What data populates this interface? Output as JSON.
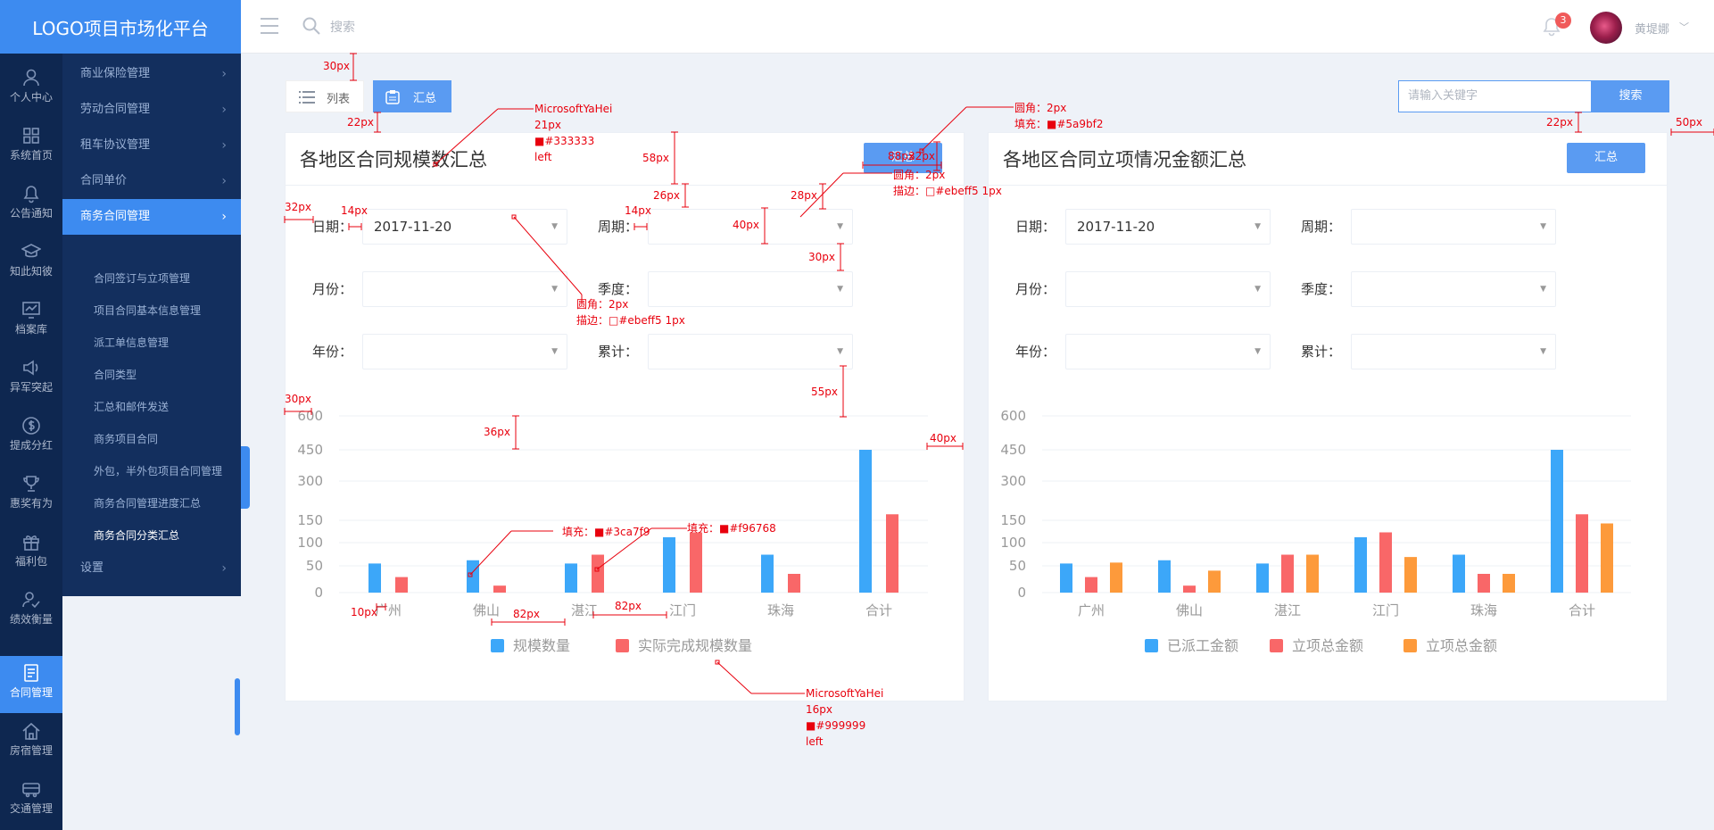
{
  "app": {
    "title": "LOGO项目市场化平台",
    "search_placeholder": "搜索",
    "notification_count": "3",
    "user_name": "黄堤娜"
  },
  "rail": [
    {
      "label": "个人中心",
      "icon": "user-icon"
    },
    {
      "label": "系统首页",
      "icon": "grid-icon"
    },
    {
      "label": "公告通知",
      "icon": "bell-icon"
    },
    {
      "label": "知此知彼",
      "icon": "cap-icon"
    },
    {
      "label": "档案库",
      "icon": "chart-icon"
    },
    {
      "label": "异军突起",
      "icon": "speaker-icon"
    },
    {
      "label": "提成分红",
      "icon": "dollar-icon"
    },
    {
      "label": "惠奖有为",
      "icon": "trophy-icon"
    },
    {
      "label": "福利包",
      "icon": "gift-icon"
    },
    {
      "label": "绩效衡量",
      "icon": "person-check-icon"
    },
    {
      "label": "合同管理",
      "icon": "contract-icon",
      "active": true
    },
    {
      "label": "房宿管理",
      "icon": "home-icon"
    },
    {
      "label": "交通管理",
      "icon": "bus-icon"
    }
  ],
  "subnav": {
    "groups": [
      "商业保险管理",
      "劳动合同管理",
      "租车协议管理",
      "合同单价",
      "商务合同管理"
    ],
    "active_group": "商务合同管理",
    "children": [
      "合同签订与立项管理",
      "项目合同基本信息管理",
      "派工单信息管理",
      "合同类型",
      "汇总和邮件发送",
      "商务项目合同",
      "外包，半外包项目合同管理",
      "商务合同管理进度汇总",
      "商务合同分类汇总"
    ],
    "current_child": "商务合同分类汇总",
    "settings": "设置"
  },
  "toolbar": {
    "list_label": "列表",
    "summary_label": "汇总",
    "keyword_placeholder": "请输入关键字",
    "search_button": "搜索"
  },
  "filters": {
    "date_label": "日期：",
    "date_value": "2017-11-20",
    "period_label": "周期：",
    "month_label": "月份：",
    "quarter_label": "季度：",
    "year_label": "年份：",
    "total_label": "累计："
  },
  "cards": [
    {
      "title": "各地区合同规模数汇总",
      "button": "汇总"
    },
    {
      "title": "各地区合同立项情况金额汇总",
      "button": "汇总"
    }
  ],
  "chart_data": [
    {
      "type": "bar",
      "categories": [
        "广州",
        "佛山",
        "湛江",
        "江门",
        "珠海",
        "合计"
      ],
      "ylim": [
        0,
        600
      ],
      "yticks": [
        0,
        50,
        100,
        150,
        300,
        450,
        600
      ],
      "series": [
        {
          "name": "规模数量",
          "values": [
            55,
            62,
            55,
            112,
            74,
            450
          ],
          "color": "#3ca7f9"
        },
        {
          "name": "实际完成规模数量",
          "values": [
            29,
            13,
            74,
            123,
            35,
            173
          ],
          "color": "#f96768"
        }
      ],
      "legend": "bottom-center"
    },
    {
      "type": "bar",
      "categories": [
        "广州",
        "佛山",
        "湛江",
        "江门",
        "珠海",
        "合计"
      ],
      "ylim": [
        0,
        600
      ],
      "yticks": [
        0,
        50,
        100,
        150,
        300,
        450,
        600
      ],
      "series": [
        {
          "name": "已派工金额",
          "values": [
            55,
            62,
            55,
            112,
            74,
            450
          ],
          "color": "#3ca7f9"
        },
        {
          "name": "立项总金额",
          "values": [
            29,
            13,
            74,
            123,
            35,
            173
          ],
          "color": "#f96768"
        },
        {
          "name": "立项总金额",
          "values": [
            57,
            41,
            74,
            69,
            35,
            143
          ],
          "color": "#fd9a3b"
        }
      ],
      "legend": "bottom-center"
    }
  ],
  "annotations": {
    "a30": "30px",
    "a22a": "22px",
    "font1_name": "MicrosoftYaHei",
    "font1_size": "21px",
    "font1_color": "■#333333",
    "font1_align": "left",
    "a58": "58px",
    "a26": "26px",
    "a28": "28px",
    "a88": "88px",
    "a32": "32px",
    "radius_btn": "圆角：2px",
    "fill_btn": "填充：■#5a9bf2",
    "radius_btn2": "圆角：2px",
    "stroke_btn2": "描边：□#ebeff5 1px",
    "a22b": "22px",
    "a50": "50px",
    "a32b": "32px",
    "a14a": "14px",
    "a14b": "14px",
    "a40": "40px",
    "a30b": "30px",
    "radius_sel": "圆角：2px",
    "stroke_sel": "描边：□#ebeff5 1px",
    "a30c": "30px",
    "a55": "55px",
    "a36": "36px",
    "a40b": "40px",
    "fill_blue": "填充：■#3ca7f9",
    "fill_red": "填充：■#f96768",
    "a10": "10px",
    "a82a": "82px",
    "a82b": "82px",
    "font2_name": "MicrosoftYaHei",
    "font2_size": "16px",
    "font2_color": "■#999999",
    "font2_align": "left"
  }
}
